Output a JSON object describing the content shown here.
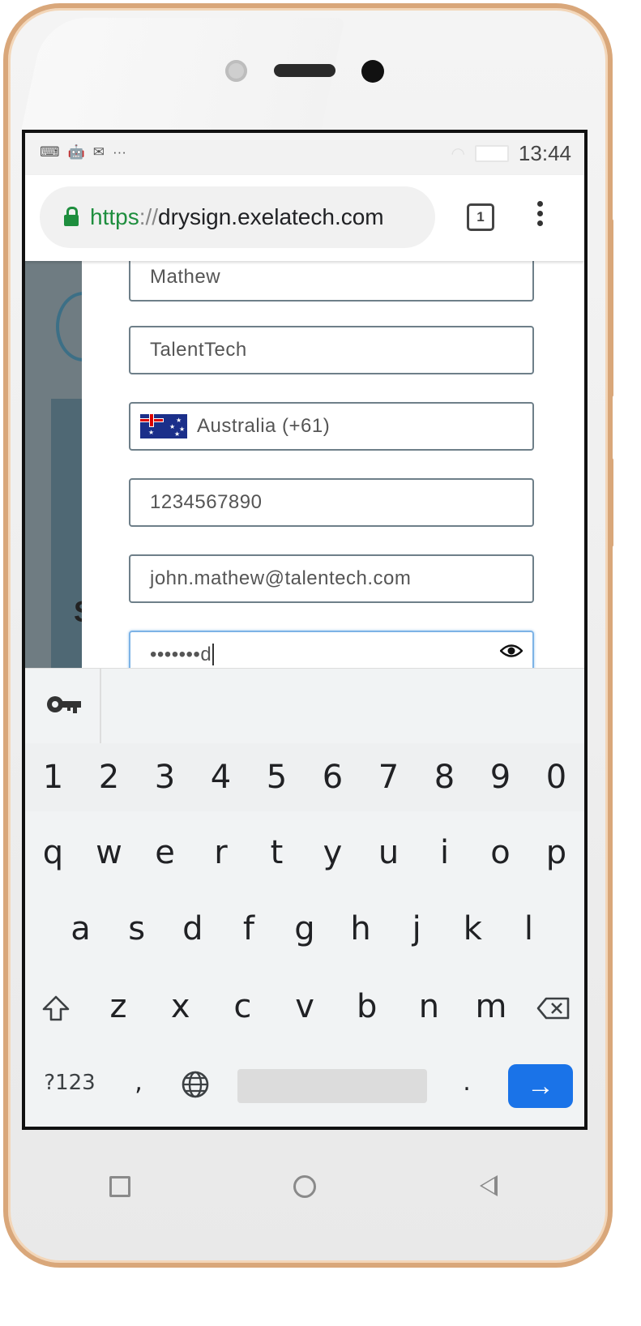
{
  "status_bar": {
    "time": "13:44",
    "left_icons": [
      "keyboard-icon",
      "android-icon",
      "gmail-icon",
      "more-notifications-icon"
    ],
    "more_glyph": "···"
  },
  "browser": {
    "url_scheme": "https",
    "url_separator": "://",
    "url_host": "drysign.exelatech.com",
    "tab_count": "1"
  },
  "form": {
    "last_name": "Mathew",
    "company": "TalentTech",
    "country": "Australia (+61)",
    "phone": "1234567890",
    "email": "john.mathew@talentech.com",
    "password_masked": "•••••••",
    "password_last_char": "d"
  },
  "page_overlay": {
    "partial_letter": "S"
  },
  "keyboard": {
    "numbers": [
      "1",
      "2",
      "3",
      "4",
      "5",
      "6",
      "7",
      "8",
      "9",
      "0"
    ],
    "row1": [
      "q",
      "w",
      "e",
      "r",
      "t",
      "y",
      "u",
      "i",
      "o",
      "p"
    ],
    "row2": [
      "a",
      "s",
      "d",
      "f",
      "g",
      "h",
      "j",
      "k",
      "l"
    ],
    "row3": [
      "z",
      "x",
      "c",
      "v",
      "b",
      "n",
      "m"
    ],
    "symbols_label": "?123",
    "comma": ",",
    "period": ".",
    "enter_glyph": "→",
    "accent_color": "#1a73e8"
  }
}
